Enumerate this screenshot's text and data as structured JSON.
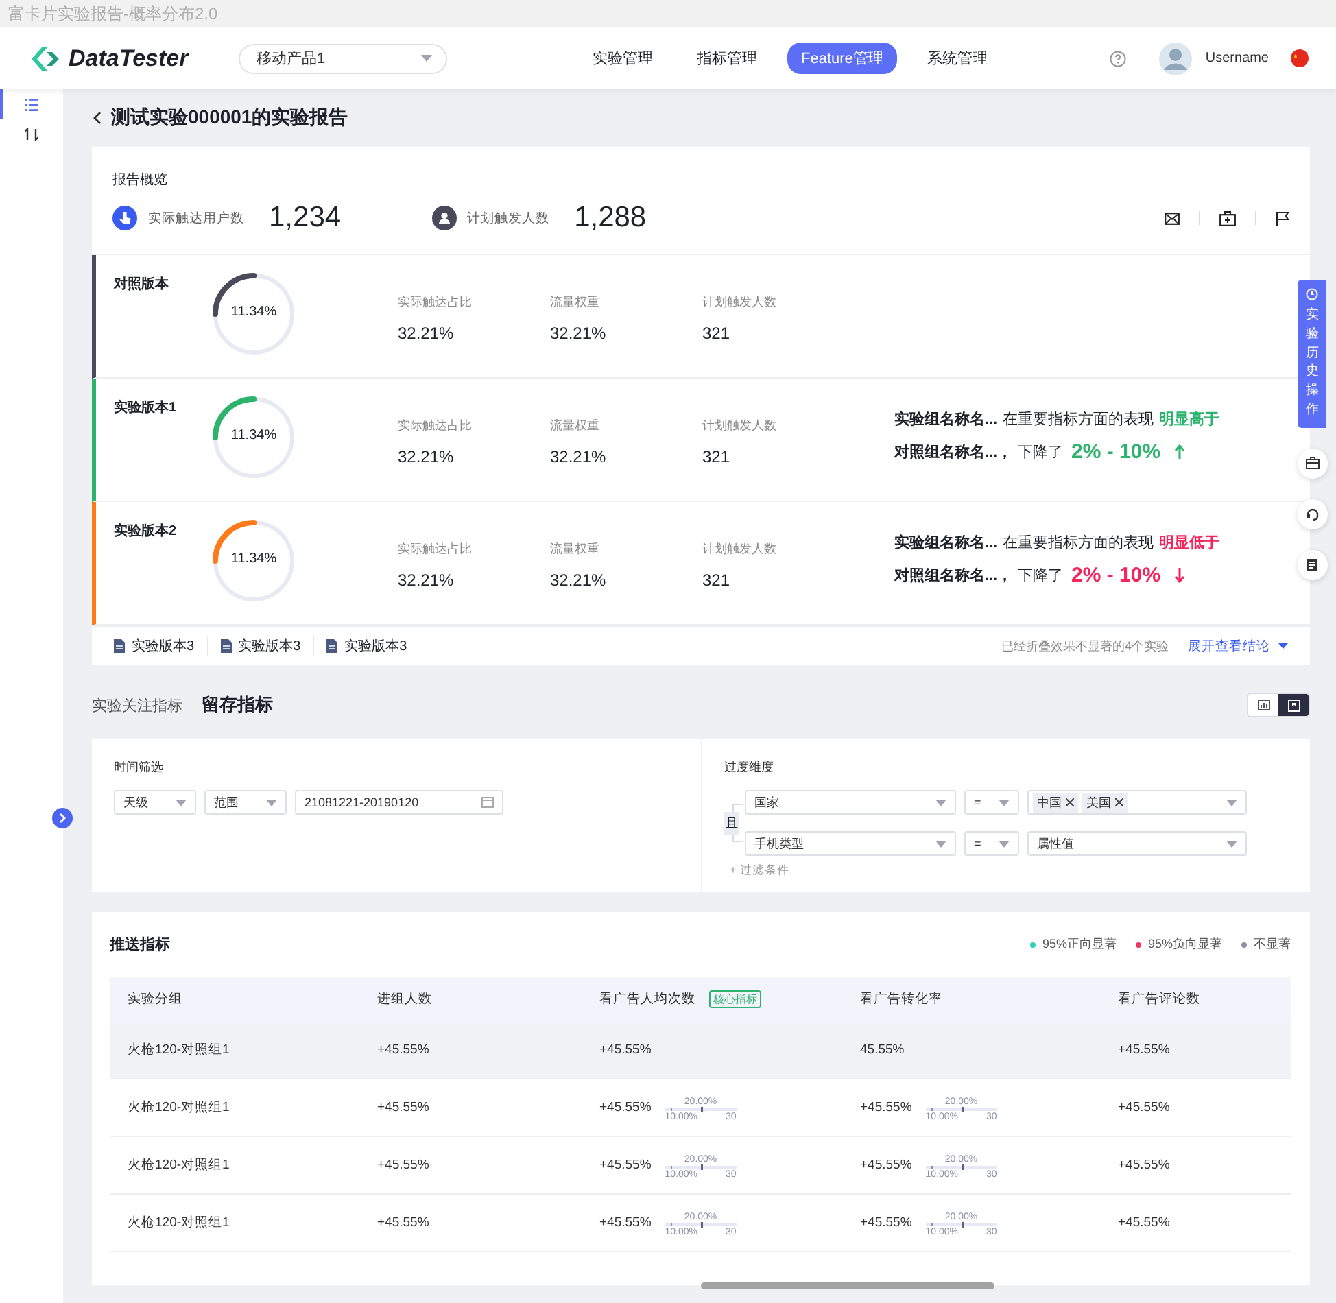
{
  "window": {
    "title": "富卡片实验报告-概率分布2.0"
  },
  "header": {
    "logo": "DataTester",
    "product_select": "移动产品1",
    "nav": [
      {
        "label": "实验管理",
        "selected": false
      },
      {
        "label": "指标管理",
        "selected": false
      },
      {
        "label": "Feature管理",
        "selected": true
      },
      {
        "label": "系统管理",
        "selected": false
      }
    ],
    "username": "Username"
  },
  "sidebar": {
    "items": [
      {
        "kind": "list",
        "selected": true
      },
      {
        "kind": "sort",
        "selected": false
      }
    ]
  },
  "page_title": "测试实验000001的实验报告",
  "overview": {
    "title": "报告概览",
    "stats": [
      {
        "kind": "touch",
        "label": "实际触达用户数",
        "value": "1,234"
      },
      {
        "kind": "user",
        "label": "计划触发人数",
        "value": "1,288"
      }
    ]
  },
  "versions": [
    {
      "name": "对照版本",
      "color": "#4a4a5a",
      "level": 0.25,
      "gauge_text": "11.34%",
      "metrics": [
        {
          "label": "实际触达占比",
          "value": "32.21%"
        },
        {
          "label": "流量权重",
          "value": "32.21%"
        },
        {
          "label": "计划触发人数",
          "value": "321"
        }
      ]
    },
    {
      "name": "实验版本1",
      "color": "#2db36d",
      "level": 0.25,
      "gauge_text": "11.34%",
      "metrics": [
        {
          "label": "实际触达占比",
          "value": "32.21%"
        },
        {
          "label": "流量权重",
          "value": "32.21%"
        },
        {
          "label": "计划触发人数",
          "value": "321"
        }
      ],
      "conclusion": {
        "group": "实验组名称名...",
        "text": "在重要指标方面的表现",
        "verdict": "明显高于",
        "baseline": "对照组名称名...，",
        "change_text": "下降了",
        "range": "2% - 10%",
        "kind": "up"
      }
    },
    {
      "name": "实验版本2",
      "color": "#ff7a1a",
      "level": 0.25,
      "gauge_text": "11.34%",
      "metrics": [
        {
          "label": "实际触达占比",
          "value": "32.21%"
        },
        {
          "label": "流量权重",
          "value": "32.21%"
        },
        {
          "label": "计划触发人数",
          "value": "321"
        }
      ],
      "conclusion": {
        "group": "实验组名称名...",
        "text": "在重要指标方面的表现",
        "verdict": "明显低于",
        "baseline": "对照组名称名...，",
        "change_text": "下降了",
        "range": "2% - 10%",
        "kind": "down"
      }
    }
  ],
  "folded": {
    "items": [
      "实验版本3",
      "实验版本3",
      "实验版本3"
    ],
    "note": "已经折叠效果不显著的4个实验",
    "link": "展开查看结论"
  },
  "metrics_section": {
    "label": "实验关注指标",
    "title": "留存指标",
    "view_toggle": [
      {
        "kind": "chart",
        "selected": false
      },
      {
        "kind": "report",
        "selected": true
      }
    ]
  },
  "filters": {
    "time": {
      "label": "时间筛选",
      "granularity": "天级",
      "mode": "范围",
      "date_range": "21081221-20190120"
    },
    "dimension": {
      "label": "过度维度",
      "logic": "且",
      "conditions": [
        {
          "field": "国家",
          "operator": "=",
          "tags": [
            "中国",
            "美国"
          ]
        },
        {
          "field": "手机类型",
          "operator": "=",
          "placeholder": "属性值"
        }
      ],
      "add": "+ 过滤条件"
    }
  },
  "table": {
    "title": "推送指标",
    "legend": [
      {
        "label": "95%正向显著",
        "color": "#2ed3b7"
      },
      {
        "label": "95%负向显著",
        "color": "#f5365c"
      },
      {
        "label": "不显著",
        "color": "#8c90a4"
      }
    ],
    "columns": [
      {
        "label": "实验分组"
      },
      {
        "label": "进组人数"
      },
      {
        "label": "看广告人均次数",
        "badge": "核心指标"
      },
      {
        "label": "看广告转化率"
      },
      {
        "label": "看广告评论数"
      }
    ],
    "rows": [
      {
        "highlighted": true,
        "cells": [
          {
            "kind": "text",
            "value": "火枪120-对照组1"
          },
          {
            "kind": "text",
            "value": "+45.55%"
          },
          {
            "kind": "text",
            "value": "+45.55%"
          },
          {
            "kind": "text",
            "value": "45.55%"
          },
          {
            "kind": "text",
            "value": "+45.55%"
          }
        ]
      },
      {
        "highlighted": false,
        "cells": [
          {
            "kind": "text",
            "value": "火枪120-对照组1"
          },
          {
            "kind": "text",
            "value": "+45.55%"
          },
          {
            "kind": "range",
            "value": "+45.55%",
            "mid": "20.00%",
            "low": "10.00%",
            "high": "30"
          },
          {
            "kind": "range",
            "value": "+45.55%",
            "mid": "20.00%",
            "low": "10.00%",
            "high": "30"
          },
          {
            "kind": "text",
            "value": "+45.55%"
          }
        ]
      },
      {
        "highlighted": false,
        "cells": [
          {
            "kind": "text",
            "value": "火枪120-对照组1"
          },
          {
            "kind": "text",
            "value": "+45.55%"
          },
          {
            "kind": "range",
            "value": "+45.55%",
            "mid": "20.00%",
            "low": "10.00%",
            "high": "30"
          },
          {
            "kind": "range",
            "value": "+45.55%",
            "mid": "20.00%",
            "low": "10.00%",
            "high": "30"
          },
          {
            "kind": "text",
            "value": "+45.55%"
          }
        ]
      },
      {
        "highlighted": false,
        "cells": [
          {
            "kind": "text",
            "value": "火枪120-对照组1"
          },
          {
            "kind": "text",
            "value": "+45.55%"
          },
          {
            "kind": "range",
            "value": "+45.55%",
            "mid": "20.00%",
            "low": "10.00%",
            "high": "30"
          },
          {
            "kind": "range",
            "value": "+45.55%",
            "mid": "20.00%",
            "low": "10.00%",
            "high": "30"
          },
          {
            "kind": "text",
            "value": "+45.55%"
          }
        ]
      }
    ]
  },
  "history_tab": "实验历史操作"
}
